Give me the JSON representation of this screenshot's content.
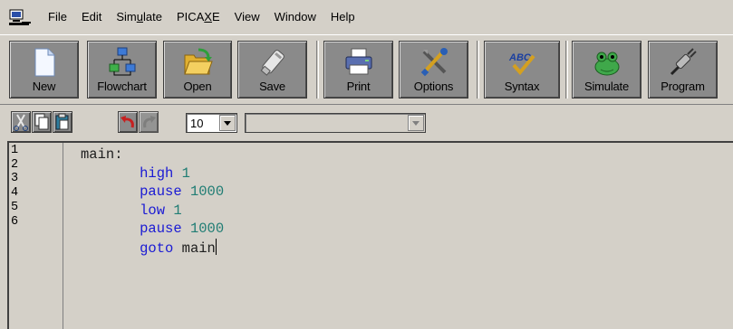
{
  "menu": {
    "items": [
      {
        "label": "File"
      },
      {
        "label": "Edit"
      },
      {
        "label": "Simulate"
      },
      {
        "label": "PICAXE"
      },
      {
        "label": "View"
      },
      {
        "label": "Window"
      },
      {
        "label": "Help"
      }
    ]
  },
  "toolbar": {
    "buttons": [
      {
        "label": "New",
        "icon": "new-document-icon"
      },
      {
        "label": "Flowchart",
        "icon": "flowchart-icon"
      },
      {
        "label": "Open",
        "icon": "open-folder-icon"
      },
      {
        "label": "Save",
        "icon": "save-usb-icon"
      },
      {
        "label": "Print",
        "icon": "printer-icon"
      },
      {
        "label": "Options",
        "icon": "tools-icon"
      },
      {
        "label": "Syntax",
        "icon": "syntax-check-icon"
      },
      {
        "label": "Simulate",
        "icon": "simulate-frog-icon"
      },
      {
        "label": "Program",
        "icon": "program-cable-icon"
      }
    ]
  },
  "toolbar2": {
    "buttons": [
      {
        "icon": "cut-icon"
      },
      {
        "icon": "copy-icon"
      },
      {
        "icon": "paste-icon"
      },
      {
        "icon": "undo-icon"
      },
      {
        "icon": "redo-icon"
      }
    ],
    "font_size": "10",
    "second_combo": ""
  },
  "editor": {
    "line_numbers": [
      "1",
      "2",
      "3",
      "4",
      "5",
      "6"
    ],
    "lines": [
      {
        "label": "main:"
      },
      {
        "keyword": "high",
        "arg": "1"
      },
      {
        "keyword": "pause",
        "arg": "1000"
      },
      {
        "keyword": "low",
        "arg": "1"
      },
      {
        "keyword": "pause",
        "arg": "1000"
      },
      {
        "keyword": "goto",
        "arg": "main"
      }
    ],
    "colors": {
      "keyword": "#1a1ad4",
      "number": "#207d74"
    }
  }
}
